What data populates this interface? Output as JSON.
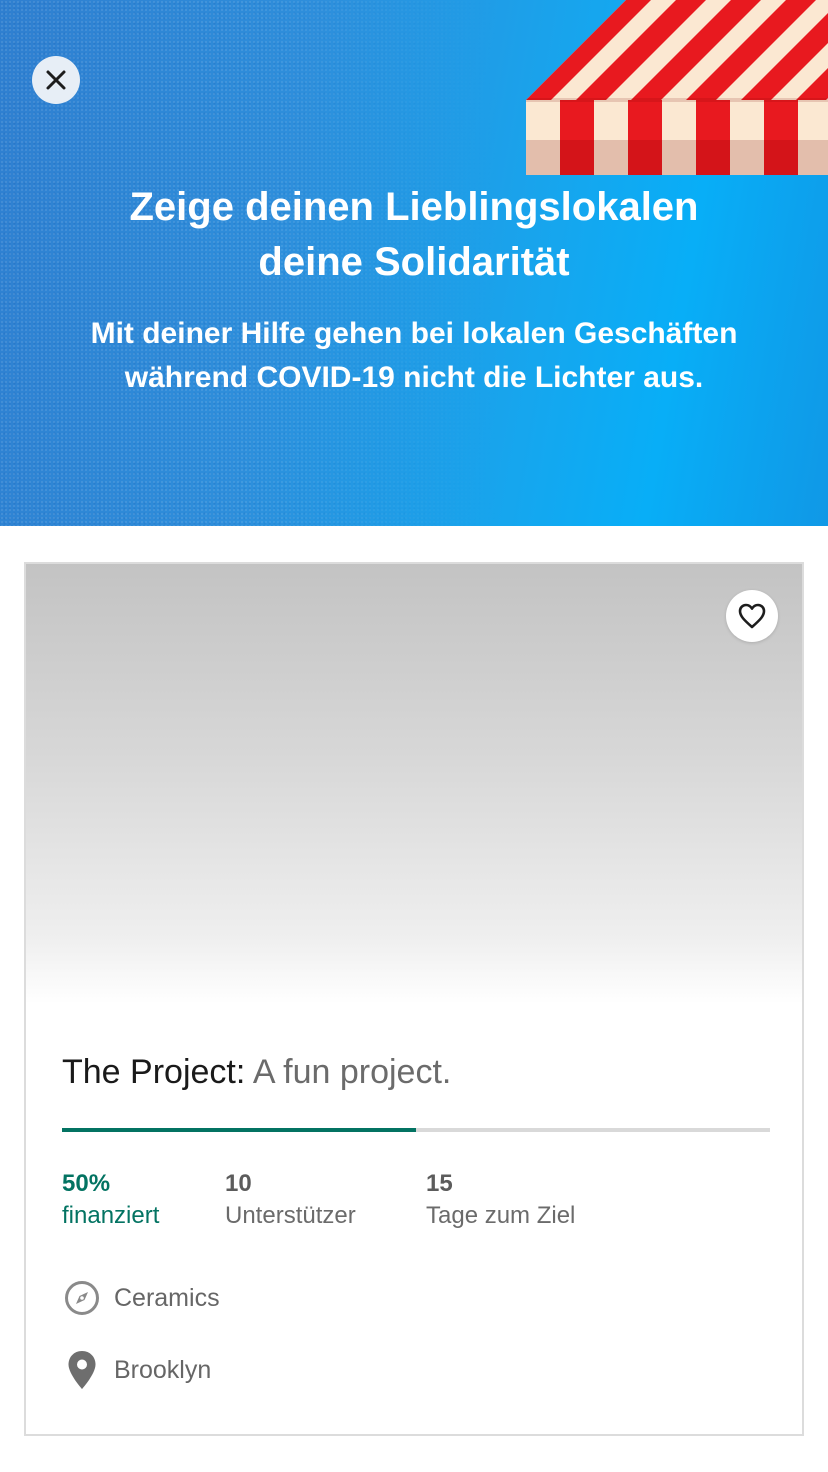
{
  "hero": {
    "title": "Zeige deinen Lieblingslokalen deine Solidarität",
    "subtitle": "Mit deiner Hilfe gehen bei lokalen Geschäften während COVID-19 nicht die Lichter aus.",
    "close_icon": "close-icon",
    "colors": {
      "primary": "#2e8fdc",
      "accent": "#08aef7",
      "awning_red": "#e8191f",
      "awning_cream": "#fbe8d2"
    }
  },
  "project": {
    "name": "The Project:",
    "blurb": "A fun project.",
    "favorite_icon": "heart-outline-icon",
    "progress_fraction": 0.5,
    "progress_color": "#037362",
    "stats": [
      {
        "value": "50%",
        "label": "finanziert"
      },
      {
        "value": "10",
        "label": "Unterstützer"
      },
      {
        "value": "15",
        "label": "Tage zum Ziel"
      }
    ],
    "category": {
      "icon": "compass-icon",
      "label": "Ceramics"
    },
    "location": {
      "icon": "map-pin-icon",
      "label": "Brooklyn"
    }
  }
}
